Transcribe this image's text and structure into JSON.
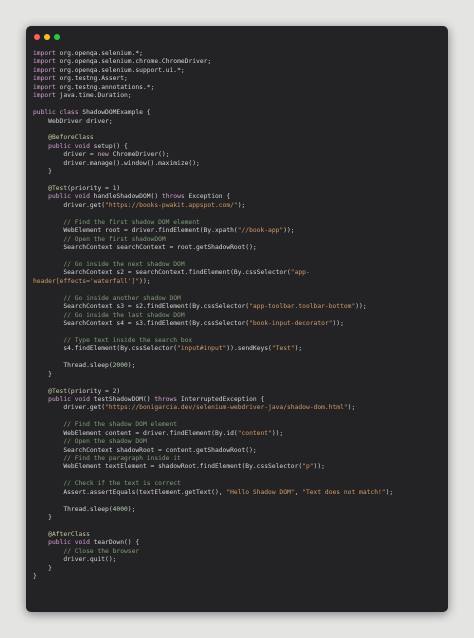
{
  "window": {
    "controls": [
      "close",
      "minimize",
      "maximize"
    ]
  },
  "code_lines": [
    [
      {
        "t": "import ",
        "c": "kw"
      },
      {
        "t": "org.openqa.selenium.*;",
        "c": ""
      }
    ],
    [
      {
        "t": "import ",
        "c": "kw"
      },
      {
        "t": "org.openqa.selenium.chrome.ChromeDriver;",
        "c": ""
      }
    ],
    [
      {
        "t": "import ",
        "c": "kw"
      },
      {
        "t": "org.openqa.selenium.support.ui.*;",
        "c": ""
      }
    ],
    [
      {
        "t": "import ",
        "c": "kw"
      },
      {
        "t": "org.testng.Assert;",
        "c": ""
      }
    ],
    [
      {
        "t": "import ",
        "c": "kw"
      },
      {
        "t": "org.testng.annotations.*;",
        "c": ""
      }
    ],
    [
      {
        "t": "import ",
        "c": "kw"
      },
      {
        "t": "java.time.Duration;",
        "c": ""
      }
    ],
    [],
    [
      {
        "t": "public class ",
        "c": "kw"
      },
      {
        "t": "ShadowDOMExample {",
        "c": ""
      }
    ],
    [
      {
        "t": "    WebDriver driver;",
        "c": ""
      }
    ],
    [],
    [
      {
        "t": "    @BeforeClass",
        "c": "ann"
      }
    ],
    [
      {
        "t": "    public void ",
        "c": "kw"
      },
      {
        "t": "setup() {",
        "c": ""
      }
    ],
    [
      {
        "t": "        driver = ",
        "c": ""
      },
      {
        "t": "new ",
        "c": "kw"
      },
      {
        "t": "ChromeDriver();",
        "c": ""
      }
    ],
    [
      {
        "t": "        driver.manage().window().maximize();",
        "c": ""
      }
    ],
    [
      {
        "t": "    }",
        "c": ""
      }
    ],
    [],
    [
      {
        "t": "    @Test",
        "c": "ann"
      },
      {
        "t": "(priority = ",
        "c": ""
      },
      {
        "t": "1",
        "c": "num"
      },
      {
        "t": ")",
        "c": ""
      }
    ],
    [
      {
        "t": "    public void ",
        "c": "kw"
      },
      {
        "t": "handleShadowDOM() ",
        "c": ""
      },
      {
        "t": "throws ",
        "c": "kw"
      },
      {
        "t": "Exception {",
        "c": ""
      }
    ],
    [
      {
        "t": "        driver.get(",
        "c": ""
      },
      {
        "t": "\"https://books-pwakit.appspot.com/\"",
        "c": "str"
      },
      {
        "t": ");",
        "c": ""
      }
    ],
    [],
    [
      {
        "t": "        // Find the first shadow DOM element",
        "c": "cm"
      }
    ],
    [
      {
        "t": "        WebElement root = driver.findElement(By.xpath(",
        "c": ""
      },
      {
        "t": "\"//book-app\"",
        "c": "str"
      },
      {
        "t": "));",
        "c": ""
      }
    ],
    [
      {
        "t": "        // Open the first shadowDOM",
        "c": "cm"
      }
    ],
    [
      {
        "t": "        SearchContext searchContext = root.getShadowRoot();",
        "c": ""
      }
    ],
    [],
    [
      {
        "t": "        // Go inside the next shadow DOM",
        "c": "cm"
      }
    ],
    [
      {
        "t": "        SearchContext s2 = searchContext.findElement(By.cssSelector(",
        "c": ""
      },
      {
        "t": "\"app-",
        "c": "str"
      }
    ],
    [
      {
        "t": "header[effects='waterfall']\"",
        "c": "str"
      },
      {
        "t": "));",
        "c": ""
      }
    ],
    [],
    [
      {
        "t": "        // Go inside another shadow DOM",
        "c": "cm"
      }
    ],
    [
      {
        "t": "        SearchContext s3 = s2.findElement(By.cssSelector(",
        "c": ""
      },
      {
        "t": "\"app-toolbar.toolbar-bottom\"",
        "c": "str"
      },
      {
        "t": "));",
        "c": ""
      }
    ],
    [
      {
        "t": "        // Go inside the last shadow DOM",
        "c": "cm"
      }
    ],
    [
      {
        "t": "        SearchContext s4 = s3.findElement(By.cssSelector(",
        "c": ""
      },
      {
        "t": "\"book-input-decorator\"",
        "c": "str"
      },
      {
        "t": "));",
        "c": ""
      }
    ],
    [],
    [
      {
        "t": "        // Type text inside the search box",
        "c": "cm"
      }
    ],
    [
      {
        "t": "        s4.findElement(By.cssSelector(",
        "c": ""
      },
      {
        "t": "\"input#input\"",
        "c": "str"
      },
      {
        "t": ")).sendKeys(",
        "c": ""
      },
      {
        "t": "\"Test\"",
        "c": "str"
      },
      {
        "t": ");",
        "c": ""
      }
    ],
    [],
    [
      {
        "t": "        Thread.sleep(",
        "c": ""
      },
      {
        "t": "2000",
        "c": "num"
      },
      {
        "t": ");",
        "c": ""
      }
    ],
    [
      {
        "t": "    }",
        "c": ""
      }
    ],
    [],
    [
      {
        "t": "    @Test",
        "c": "ann"
      },
      {
        "t": "(priority = ",
        "c": ""
      },
      {
        "t": "2",
        "c": "num"
      },
      {
        "t": ")",
        "c": ""
      }
    ],
    [
      {
        "t": "    public void ",
        "c": "kw"
      },
      {
        "t": "testShadowDOM() ",
        "c": ""
      },
      {
        "t": "throws ",
        "c": "kw"
      },
      {
        "t": "InterruptedException {",
        "c": ""
      }
    ],
    [
      {
        "t": "        driver.get(",
        "c": ""
      },
      {
        "t": "\"https://bonigarcia.dev/selenium-webdriver-java/shadow-dom.html\"",
        "c": "str"
      },
      {
        "t": ");",
        "c": ""
      }
    ],
    [],
    [
      {
        "t": "        // Find the shadow DOM element",
        "c": "cm"
      }
    ],
    [
      {
        "t": "        WebElement content = driver.findElement(By.id(",
        "c": ""
      },
      {
        "t": "\"content\"",
        "c": "str"
      },
      {
        "t": "));",
        "c": ""
      }
    ],
    [
      {
        "t": "        // Open the shadow DOM",
        "c": "cm"
      }
    ],
    [
      {
        "t": "        SearchContext shadowRoot = content.getShadowRoot();",
        "c": ""
      }
    ],
    [
      {
        "t": "        // Find the paragraph inside it",
        "c": "cm"
      }
    ],
    [
      {
        "t": "        WebElement textElement = shadowRoot.findElement(By.cssSelector(",
        "c": ""
      },
      {
        "t": "\"p\"",
        "c": "str"
      },
      {
        "t": "));",
        "c": ""
      }
    ],
    [],
    [
      {
        "t": "        // Check if the text is correct",
        "c": "cm"
      }
    ],
    [
      {
        "t": "        Assert.assertEquals(textElement.getText(), ",
        "c": ""
      },
      {
        "t": "\"Hello Shadow DOM\"",
        "c": "str"
      },
      {
        "t": ", ",
        "c": ""
      },
      {
        "t": "\"Text does not match!\"",
        "c": "str"
      },
      {
        "t": ");",
        "c": ""
      }
    ],
    [],
    [
      {
        "t": "        Thread.sleep(",
        "c": ""
      },
      {
        "t": "4000",
        "c": "num"
      },
      {
        "t": ");",
        "c": ""
      }
    ],
    [
      {
        "t": "    }",
        "c": ""
      }
    ],
    [],
    [
      {
        "t": "    @AfterClass",
        "c": "ann"
      }
    ],
    [
      {
        "t": "    public void ",
        "c": "kw"
      },
      {
        "t": "tearDown() {",
        "c": ""
      }
    ],
    [
      {
        "t": "        // Close the browser",
        "c": "cm"
      }
    ],
    [
      {
        "t": "        driver.quit();",
        "c": ""
      }
    ],
    [
      {
        "t": "    }",
        "c": ""
      }
    ],
    [
      {
        "t": "}",
        "c": ""
      }
    ]
  ]
}
